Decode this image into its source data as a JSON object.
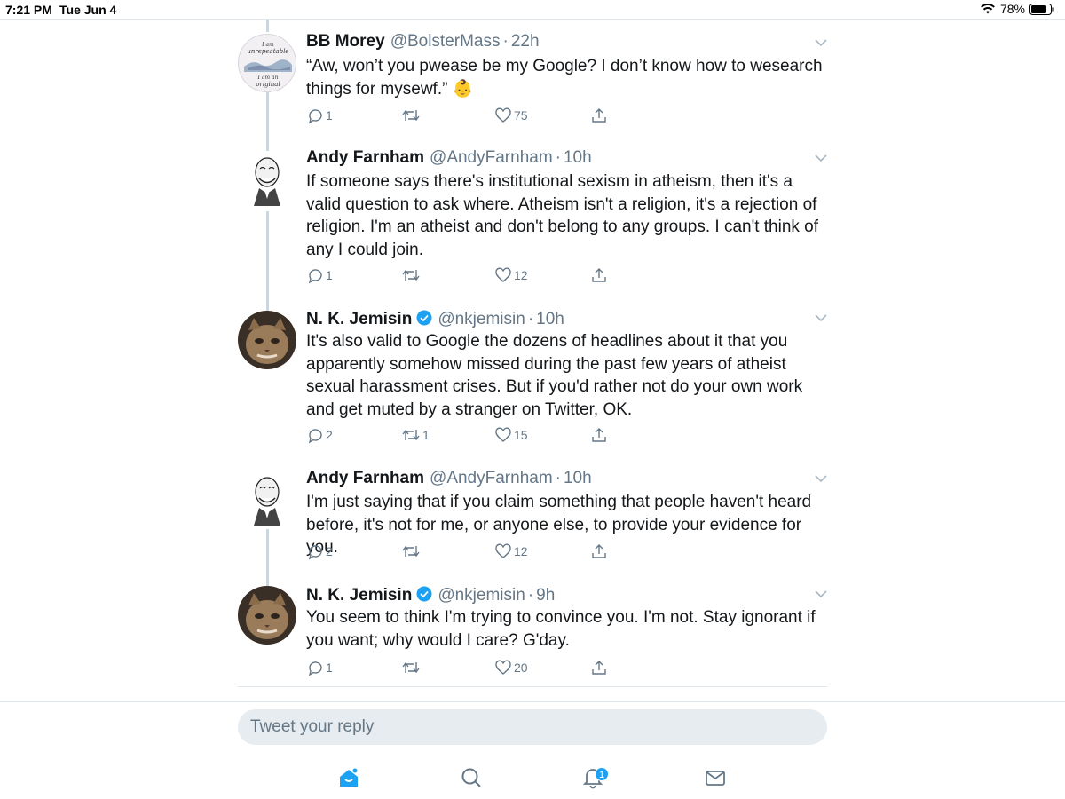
{
  "status_bar": {
    "time": "7:21 PM",
    "date": "Tue Jun 4",
    "battery": "78%",
    "icons": [
      "wifi-icon",
      "battery-icon"
    ]
  },
  "colors": {
    "accent": "#1da1f2",
    "verified": "#1da1f2",
    "muted_text": "#657786",
    "thread_line": "#ccd6dd",
    "reply_bg": "#e6ecf0"
  },
  "tweets": [
    {
      "name": "BB Morey",
      "handle": "@BolsterMass",
      "separator": "·",
      "time": "22h",
      "verified": false,
      "text": "“Aw, won’t you pwease be my Google? I don’t know how to wesearch things for mysewf.” 👶",
      "replies": "1",
      "retweets": "",
      "likes": "75",
      "avatar": {
        "icon": "original-quote-avatar",
        "lines": [
          "I am",
          "unrepeatable",
          "I am an",
          "original"
        ]
      }
    },
    {
      "name": "Andy Farnham",
      "handle": "@AndyFarnham",
      "separator": "·",
      "time": "10h",
      "verified": false,
      "text": "If someone says there's institutional sexism in atheism, then it's a valid question to ask where. Atheism isn't a religion, it's a rejection of religion. I'm an atheist and don't belong to any groups. I can't think of any I could join.",
      "replies": "1",
      "retweets": "",
      "likes": "12",
      "avatar": {
        "icon": "caricature-avatar"
      }
    },
    {
      "name": "N. K. Jemisin",
      "handle": "@nkjemisin",
      "separator": "·",
      "time": "10h",
      "verified": true,
      "text": "It's also valid to Google the dozens of headlines about it that you apparently somehow missed during the past few years of atheist sexual harassment crises. But if you'd rather not do your own work and get muted by a stranger on Twitter, OK.",
      "replies": "2",
      "retweets": "1",
      "likes": "15",
      "avatar": {
        "icon": "cat-avatar"
      }
    },
    {
      "name": "Andy Farnham",
      "handle": "@AndyFarnham",
      "separator": "·",
      "time": "10h",
      "verified": false,
      "text": "I'm just saying that if you claim something that people haven't heard before, it's not for me, or anyone else, to provide your evidence for you.",
      "replies": "2",
      "retweets": "",
      "likes": "12",
      "avatar": {
        "icon": "caricature-avatar"
      }
    },
    {
      "name": "N. K. Jemisin",
      "handle": "@nkjemisin",
      "separator": "·",
      "time": "9h",
      "verified": true,
      "text": "You seem to think I'm trying to convince you. I'm not. Stay ignorant if you want; why would I care? G'day.",
      "replies": "1",
      "retweets": "",
      "likes": "20",
      "avatar": {
        "icon": "cat-avatar"
      }
    }
  ],
  "reply": {
    "placeholder": "Tweet your reply",
    "value": ""
  },
  "tab_bar": {
    "tabs": [
      {
        "name": "home",
        "icon": "home-icon",
        "active": true,
        "badge": ""
      },
      {
        "name": "search",
        "icon": "search-icon",
        "active": false,
        "badge": ""
      },
      {
        "name": "notifications",
        "icon": "bell-icon",
        "active": false,
        "badge": "1"
      },
      {
        "name": "messages",
        "icon": "envelope-icon",
        "active": false,
        "badge": ""
      }
    ]
  }
}
